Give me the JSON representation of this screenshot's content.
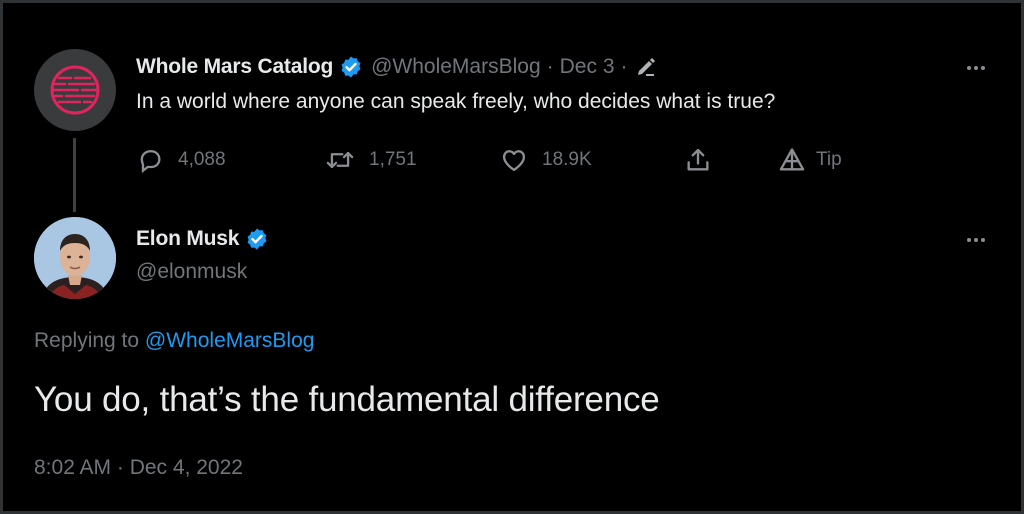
{
  "parent_tweet": {
    "display_name": "Whole Mars Catalog",
    "handle": "@WholeMarsBlog",
    "separator": "·",
    "date": "Dec 3",
    "text": "In a world where anyone can speak freely, who decides what is true?",
    "actions": {
      "replies": "4,088",
      "retweets": "1,751",
      "likes": "18.9K",
      "tip_label": "Tip"
    },
    "icons": [
      "edit-icon",
      "verified-badge-icon",
      "more-icon",
      "reply-icon",
      "retweet-icon",
      "like-icon",
      "share-icon",
      "tip-icon"
    ]
  },
  "main_tweet": {
    "display_name": "Elon Musk",
    "handle": "@elonmusk",
    "replying_prefix": "Replying to",
    "replying_to": "@WholeMarsBlog",
    "text": "You do, that’s the fundamental difference",
    "timestamp": "8:02 AM · Dec 4, 2022"
  },
  "colors": {
    "background": "#000000",
    "text_primary": "#e7e9ea",
    "text_secondary": "#71767b",
    "accent": "#1d9bf0",
    "parent_logo": "#e0245e"
  }
}
